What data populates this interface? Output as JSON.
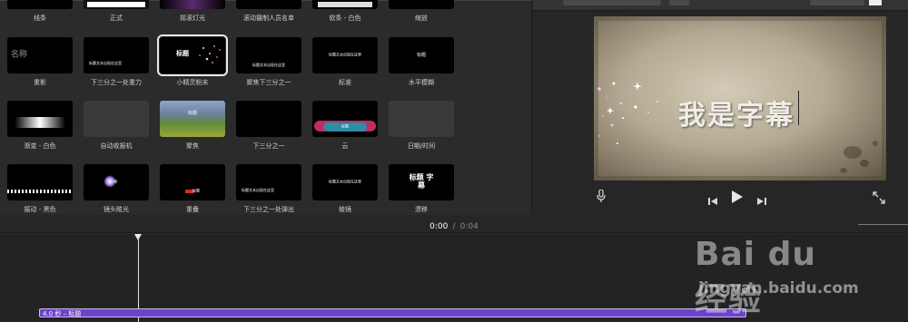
{
  "browser": {
    "rows": [
      [
        {
          "label": "线条"
        },
        {
          "label": "正式"
        },
        {
          "label": "摇滚灯光"
        },
        {
          "label": "滚动摄制人员名单"
        },
        {
          "label": "软条 - 白色"
        },
        {
          "label": "缩放"
        }
      ],
      [
        {
          "label": "重影",
          "thumb_text": "名称"
        },
        {
          "label": "下三分之一处重力",
          "thumb_text": "标题文本出现在这里"
        },
        {
          "label": "小精灵粉末",
          "thumb_text": "标题",
          "selected": true
        },
        {
          "label": "聚焦下三分之一",
          "thumb_text": "标题文本出现在这里"
        },
        {
          "label": "标准",
          "thumb_text": "标题文本出现在这里"
        },
        {
          "label": "水平模糊",
          "thumb_text": "标题"
        }
      ],
      [
        {
          "label": "渐变 - 白色"
        },
        {
          "label": "自动收报机"
        },
        {
          "label": "聚焦",
          "thumb_text": "标题"
        },
        {
          "label": "下三分之一"
        },
        {
          "label": "云",
          "thumb_text": "标题"
        },
        {
          "label": "日期/时间"
        }
      ],
      [
        {
          "label": "振动 - 黑色"
        },
        {
          "label": "镜头眩光"
        },
        {
          "label": "重叠",
          "thumb_text": "标题"
        },
        {
          "label": "下三分之一处弹出",
          "thumb_text": "标题文本出现在这里"
        },
        {
          "label": "棱镜",
          "thumb_text": "标题文本出现在这里"
        },
        {
          "label": "漂移",
          "thumb_text": "标题 字幕"
        }
      ]
    ]
  },
  "viewer": {
    "caption": "我是字幕",
    "icons": {
      "mic": "microphone-icon",
      "prev": "skip-back-icon",
      "play": "play-icon",
      "next": "skip-forward-icon",
      "fullscreen": "fullscreen-icon"
    }
  },
  "timeline": {
    "current_time": "0:00",
    "separator": "/",
    "total_time": "0:04",
    "clip_label": "4.0 秒 – 标题",
    "clip_color": "#6b43c9"
  },
  "watermark": {
    "logo": "Bai du 经验",
    "url": "jingyan.baidu.com"
  }
}
